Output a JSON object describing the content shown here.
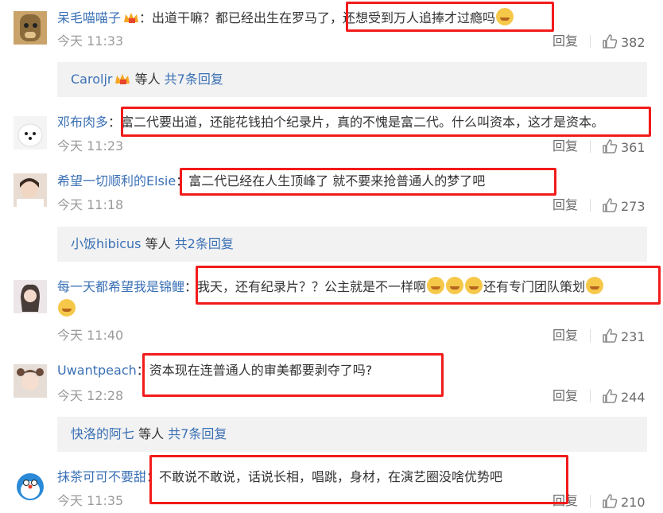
{
  "comments": [
    {
      "user": "呆毛喵喵子",
      "text": "：出道干嘛？都已经出生在罗马了，还想受到万人追捧才过瘾吗",
      "time": "今天 11:33",
      "reply": "回复",
      "likes": "382"
    },
    {
      "user": "邓布肉多",
      "text": "：富二代要出道，还能花钱拍个纪录片，真的不愧是富二代。什么叫资本，这才是资本。",
      "time": "今天 11:23",
      "reply": "回复",
      "likes": "361"
    },
    {
      "user": "希望一切顺利的Elsie",
      "text": "：富二代已经在人生顶峰了 就不要来抢普通人的梦了吧",
      "time": "今天 11:18",
      "reply": "回复",
      "likes": "273"
    },
    {
      "user": "每一天都希望我是锦鲤",
      "text": "：我天，还有纪录片？？公主就是不一样啊",
      "text2": "还有专门团队策划",
      "time": "今天 11:40",
      "reply": "回复",
      "likes": "231"
    },
    {
      "user": "Uwantpeach",
      "text": "：资本现在连普通人的审美都要剥夺了吗?",
      "time": "今天 12:28",
      "reply": "回复",
      "likes": "244"
    },
    {
      "user": "抹茶可可不要甜",
      "text": "：不敢说不敢说，话说长相，唱跳，身材，在演艺圈没啥优势吧",
      "time": "今天 11:35",
      "reply": "回复",
      "likes": "210"
    }
  ],
  "replies": [
    {
      "user": "Caroljr",
      "mid": "等人",
      "count": "共7条回复"
    },
    {
      "user": "小饭hibicus",
      "mid": "等人",
      "count": "共2条回复"
    },
    {
      "user": "快洛的阿七",
      "mid": "等人",
      "count": "共7条回复"
    }
  ],
  "colors": {
    "link": "#3a70b5",
    "highlight": "#f21b1b",
    "subbg": "#f2f2f2"
  }
}
